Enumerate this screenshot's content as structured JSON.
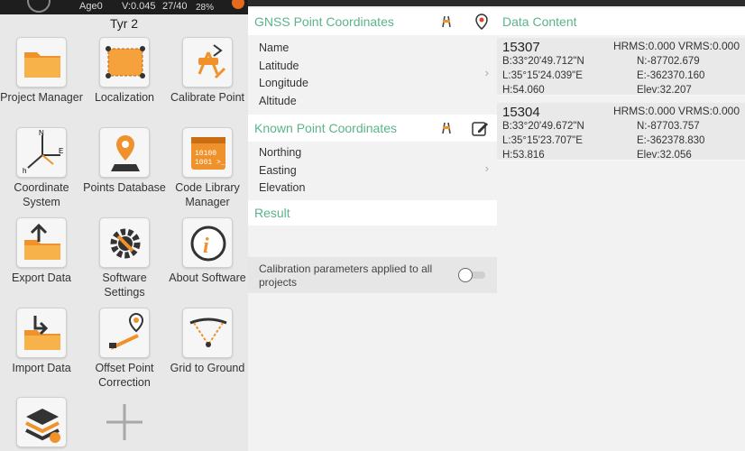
{
  "status": {
    "age": "Age0",
    "version": "V:0.045",
    "sats": "27/40",
    "battery": "28%"
  },
  "device_title": "Tyr 2",
  "tiles": [
    {
      "label": "Project Manager",
      "icon": "folder-icon"
    },
    {
      "label": "Localization",
      "icon": "localization-map-icon"
    },
    {
      "label": "Calibrate Point",
      "icon": "calibrate-point-icon"
    },
    {
      "label": "Coordinate System",
      "icon": "coordinate-axes-icon"
    },
    {
      "label": "Points Database",
      "icon": "map-pin-icon"
    },
    {
      "label": "Code Library Manager",
      "icon": "binary-code-icon"
    },
    {
      "label": "Export Data",
      "icon": "export-folder-icon"
    },
    {
      "label": "Software Settings",
      "icon": "gear-wrench-icon"
    },
    {
      "label": "About Software",
      "icon": "info-icon"
    },
    {
      "label": "Import Data",
      "icon": "import-folder-icon"
    },
    {
      "label": "Offset Point Correction",
      "icon": "offset-point-icon"
    },
    {
      "label": "Grid to Ground",
      "icon": "grid-to-ground-icon"
    },
    {
      "label": "",
      "icon": "layers-settings-icon"
    },
    {
      "label": "",
      "icon": "plus-icon"
    }
  ],
  "gnss": {
    "title": "GNSS Point Coordinates",
    "fields": [
      "Name",
      "Latitude",
      "Longitude",
      "Altitude"
    ]
  },
  "known": {
    "title": "Known Point Coordinates",
    "fields": [
      "Northing",
      "Easting",
      "Elevation"
    ]
  },
  "result": {
    "title": "Result"
  },
  "calibration": {
    "label": "Calibration parameters applied to all projects",
    "enabled": false
  },
  "data_content": {
    "title": "Data Content",
    "records": [
      {
        "name": "15307",
        "rms": "HRMS:0.000 VRMS:0.000",
        "b": "B:33°20'49.712\"N",
        "l": "L:35°15'24.039\"E",
        "h": "H:54.060",
        "n": "N:-87702.679",
        "e": "E:-362370.160",
        "elev": "Elev:32.207"
      },
      {
        "name": "15304",
        "rms": "HRMS:0.000 VRMS:0.000",
        "b": "B:33°20'49.672\"N",
        "l": "L:35°15'23.707\"E",
        "h": "H:53.816",
        "n": "N:-87703.757",
        "e": "E:-362378.830",
        "elev": "Elev:32.056"
      }
    ]
  },
  "colors": {
    "accent_green": "#5bb48a",
    "orange": "#f0922b"
  }
}
